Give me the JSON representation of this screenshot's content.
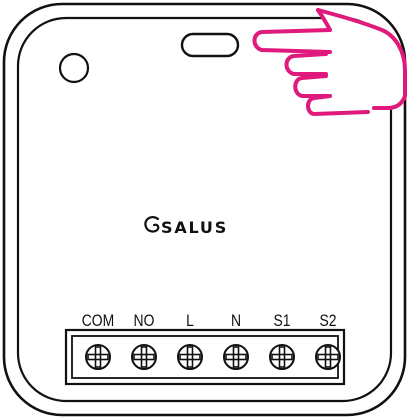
{
  "device": {
    "brand": "SALUS",
    "terminals": [
      "COM",
      "NO",
      "L",
      "N",
      "S1",
      "S2"
    ]
  },
  "colors": {
    "outline": "#111111",
    "pointer_hand": "#e0197d",
    "background": "#ffffff"
  },
  "icons": {
    "pointer": "pointing-hand-icon",
    "screw": "terminal-screw-icon",
    "logo": "salus-logo-icon"
  }
}
